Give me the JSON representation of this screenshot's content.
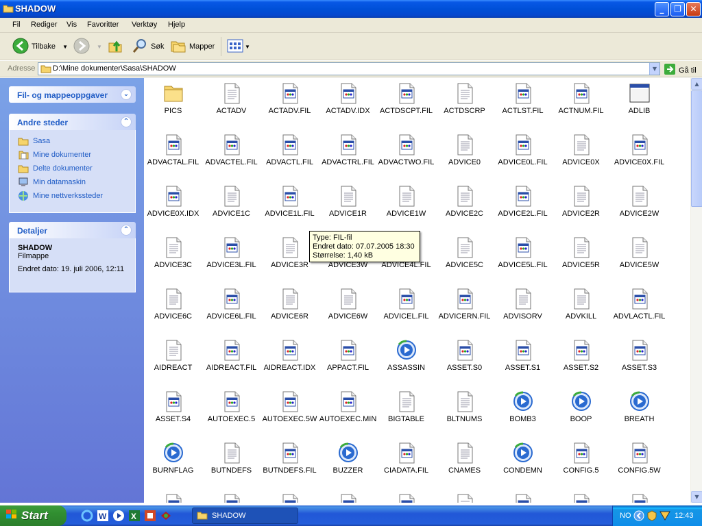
{
  "window": {
    "title": "SHADOW"
  },
  "menu": [
    "Fil",
    "Rediger",
    "Vis",
    "Favoritter",
    "Verktøy",
    "Hjelp"
  ],
  "toolbar": {
    "back": "Tilbake",
    "search": "Søk",
    "folders": "Mapper"
  },
  "address": {
    "label": "Adresse",
    "path": "D:\\Mine dokumenter\\Sasa\\SHADOW",
    "go": "Gå til"
  },
  "taskpane": {
    "tasks_title": "Fil- og mappeoppgaver",
    "other_title": "Andre steder",
    "other_links": [
      {
        "label": "Sasa",
        "icon": "folder-icon"
      },
      {
        "label": "Mine dokumenter",
        "icon": "documents-icon"
      },
      {
        "label": "Delte dokumenter",
        "icon": "folder-icon"
      },
      {
        "label": "Min datamaskin",
        "icon": "computer-icon"
      },
      {
        "label": "Mine nettverkssteder",
        "icon": "network-icon"
      }
    ],
    "details_title": "Detaljer",
    "details": {
      "name": "SHADOW",
      "type": "Filmappe",
      "modified": "Endret dato: 19. juli 2006, 12:11"
    }
  },
  "files": [
    {
      "name": "PICS",
      "icon": "folder"
    },
    {
      "name": "ACTADV",
      "icon": "text"
    },
    {
      "name": "ACTADV.FIL",
      "icon": "fil"
    },
    {
      "name": "ACTADV.IDX",
      "icon": "fil"
    },
    {
      "name": "ACTDSCPT.FIL",
      "icon": "fil"
    },
    {
      "name": "ACTDSCRP",
      "icon": "text"
    },
    {
      "name": "ACTLST.FIL",
      "icon": "fil"
    },
    {
      "name": "ACTNUM.FIL",
      "icon": "fil"
    },
    {
      "name": "ADLIB",
      "icon": "window"
    },
    {
      "name": "ADVACTAL.FIL",
      "icon": "fil"
    },
    {
      "name": "ADVACTEL.FIL",
      "icon": "fil"
    },
    {
      "name": "ADVACTL.FIL",
      "icon": "fil"
    },
    {
      "name": "ADVACTRL.FIL",
      "icon": "fil"
    },
    {
      "name": "ADVACTWO.FIL",
      "icon": "fil"
    },
    {
      "name": "ADVICE0",
      "icon": "text"
    },
    {
      "name": "ADVICE0L.FIL",
      "icon": "fil"
    },
    {
      "name": "ADVICE0X",
      "icon": "text"
    },
    {
      "name": "ADVICE0X.FIL",
      "icon": "fil"
    },
    {
      "name": "ADVICE0X.IDX",
      "icon": "fil"
    },
    {
      "name": "ADVICE1C",
      "icon": "text"
    },
    {
      "name": "ADVICE1L.FIL",
      "icon": "fil"
    },
    {
      "name": "ADVICE1R",
      "icon": "text"
    },
    {
      "name": "ADVICE1W",
      "icon": "text"
    },
    {
      "name": "ADVICE2C",
      "icon": "text"
    },
    {
      "name": "ADVICE2L.FIL",
      "icon": "fil"
    },
    {
      "name": "ADVICE2R",
      "icon": "text"
    },
    {
      "name": "ADVICE2W",
      "icon": "text"
    },
    {
      "name": "ADVICE3C",
      "icon": "text"
    },
    {
      "name": "ADVICE3L.FIL",
      "icon": "fil"
    },
    {
      "name": "ADVICE3R",
      "icon": "text"
    },
    {
      "name": "ADVICE3W",
      "icon": "text"
    },
    {
      "name": "ADVICE4L.FIL",
      "icon": "fil"
    },
    {
      "name": "ADVICE5C",
      "icon": "text"
    },
    {
      "name": "ADVICE5L.FIL",
      "icon": "fil"
    },
    {
      "name": "ADVICE5R",
      "icon": "text"
    },
    {
      "name": "ADVICE5W",
      "icon": "text"
    },
    {
      "name": "ADVICE6C",
      "icon": "text"
    },
    {
      "name": "ADVICE6L.FIL",
      "icon": "fil"
    },
    {
      "name": "ADVICE6R",
      "icon": "text"
    },
    {
      "name": "ADVICE6W",
      "icon": "text"
    },
    {
      "name": "ADVICEL.FIL",
      "icon": "fil"
    },
    {
      "name": "ADVICERN.FIL",
      "icon": "fil"
    },
    {
      "name": "ADVISORV",
      "icon": "text"
    },
    {
      "name": "ADVKILL",
      "icon": "text"
    },
    {
      "name": "ADVLACTL.FIL",
      "icon": "fil"
    },
    {
      "name": "AIDREACT",
      "icon": "text"
    },
    {
      "name": "AIDREACT.FIL",
      "icon": "fil"
    },
    {
      "name": "AIDREACT.IDX",
      "icon": "fil"
    },
    {
      "name": "APPACT.FIL",
      "icon": "fil"
    },
    {
      "name": "ASSASSIN",
      "icon": "media"
    },
    {
      "name": "ASSET.S0",
      "icon": "fil"
    },
    {
      "name": "ASSET.S1",
      "icon": "fil"
    },
    {
      "name": "ASSET.S2",
      "icon": "fil"
    },
    {
      "name": "ASSET.S3",
      "icon": "fil"
    },
    {
      "name": "ASSET.S4",
      "icon": "fil"
    },
    {
      "name": "AUTOEXEC.5",
      "icon": "fil"
    },
    {
      "name": "AUTOEXEC.5W",
      "icon": "fil"
    },
    {
      "name": "AUTOEXEC.MIN",
      "icon": "fil"
    },
    {
      "name": "BIGTABLE",
      "icon": "text"
    },
    {
      "name": "BLTNUMS",
      "icon": "text"
    },
    {
      "name": "BOMB3",
      "icon": "media"
    },
    {
      "name": "BOOP",
      "icon": "media"
    },
    {
      "name": "BREATH",
      "icon": "media"
    },
    {
      "name": "BURNFLAG",
      "icon": "media"
    },
    {
      "name": "BUTNDEFS",
      "icon": "text"
    },
    {
      "name": "BUTNDEFS.FIL",
      "icon": "fil"
    },
    {
      "name": "BUZZER",
      "icon": "media"
    },
    {
      "name": "CIADATA.FIL",
      "icon": "fil"
    },
    {
      "name": "CNAMES",
      "icon": "text"
    },
    {
      "name": "CONDEMN",
      "icon": "media"
    },
    {
      "name": "CONFIG.5",
      "icon": "fil"
    },
    {
      "name": "CONFIG.5W",
      "icon": "fil"
    },
    {
      "name": "",
      "icon": "fil"
    },
    {
      "name": "",
      "icon": "fil"
    },
    {
      "name": "",
      "icon": "fil"
    },
    {
      "name": "",
      "icon": "fil"
    },
    {
      "name": "",
      "icon": "fil"
    },
    {
      "name": "",
      "icon": "text"
    },
    {
      "name": "",
      "icon": "fil"
    },
    {
      "name": "",
      "icon": "fil"
    },
    {
      "name": "",
      "icon": "fil"
    }
  ],
  "tooltip": {
    "type": "Type: FIL-fil",
    "modified": "Endret dato: 07.07.2005 18:30",
    "size": "Størrelse: 1,40 kB"
  },
  "taskbar": {
    "start": "Start",
    "task_label": "SHADOW",
    "lang": "NO",
    "clock": "12:43"
  }
}
